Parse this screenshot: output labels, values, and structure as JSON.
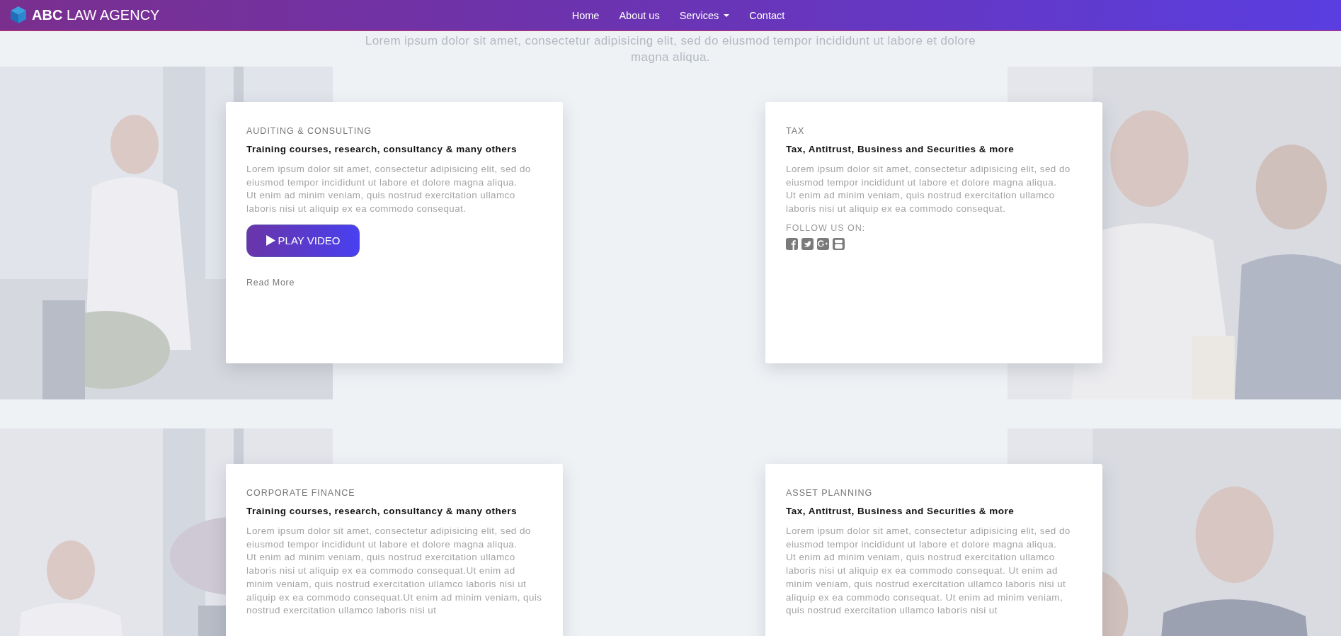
{
  "header": {
    "brand_bold": "ABC",
    "brand_rest": "LAW AGENCY",
    "nav": [
      {
        "label": "Home",
        "dropdown": false
      },
      {
        "label": "About us",
        "dropdown": false
      },
      {
        "label": "Services",
        "dropdown": true
      },
      {
        "label": "Contact",
        "dropdown": false
      }
    ]
  },
  "intro": "Lorem ipsum dolor sit amet, consectetur adipisicing elit, sed do eiusmod tempor incididunt ut labore et dolore magna aliqua.",
  "rows": [
    {
      "cards": [
        {
          "category": "AUDITING & CONSULTING",
          "heading": "Training courses, research, consultancy & many others",
          "paragraphs": [
            "Lorem ipsum dolor sit amet, consectetur adipisicing elit, sed do eiusmod tempor incididunt ut labore et dolore magna aliqua.",
            "Ut enim ad minim veniam, quis nostrud exercitation ullamco laboris nisi ut aliquip ex ea commodo consequat."
          ],
          "extras": [
            {
              "kind": "play_button",
              "label": "PLAY VIDEO"
            },
            {
              "kind": "link",
              "label": "Read More"
            }
          ]
        },
        {
          "category": "TAX",
          "heading": "Tax, Antitrust, Business and Securities & more",
          "paragraphs": [
            "Lorem ipsum dolor sit amet, consectetur adipisicing elit, sed do eiusmod tempor incididunt ut labore et dolore magna aliqua.",
            "Ut enim ad minim veniam, quis nostrud exercitation ullamco laboris nisi ut aliquip ex ea commodo consequat."
          ],
          "extras": [
            {
              "kind": "follow",
              "label": "FOLLOW US ON:"
            }
          ]
        }
      ]
    },
    {
      "cards": [
        {
          "category": "CORPORATE FINANCE",
          "heading": "Training courses, research, consultancy & many others",
          "paragraphs": [
            "Lorem ipsum dolor sit amet, consectetur adipisicing elit, sed do eiusmod tempor incididunt ut labore et dolore magna aliqua.",
            "Ut enim ad minim veniam, quis nostrud exercitation ullamco laboris nisi ut aliquip ex ea commodo consequat.Ut enim ad minim veniam, quis nostrud exercitation ullamco laboris nisi ut aliquip ex ea commodo consequat.Ut enim ad minim veniam, quis nostrud exercitation ullamco laboris nisi ut"
          ]
        },
        {
          "category": "ASSET PLANNING",
          "heading": "Tax, Antitrust, Business and Securities & more",
          "paragraphs": [
            "Lorem ipsum dolor sit amet, consectetur adipisicing elit, sed do eiusmod tempor incididunt ut labore et dolore magna aliqua.",
            "Ut enim ad minim veniam, quis nostrud exercitation ullamco laboris nisi ut aliquip ex ea commodo consequat. Ut enim ad minim veniam, quis nostrud exercitation ullamco laboris nisi ut aliquip ex ea commodo consequat. Ut enim ad minim veniam, quis nostrud exercitation ullamco laboris nisi ut"
          ]
        }
      ]
    }
  ]
}
